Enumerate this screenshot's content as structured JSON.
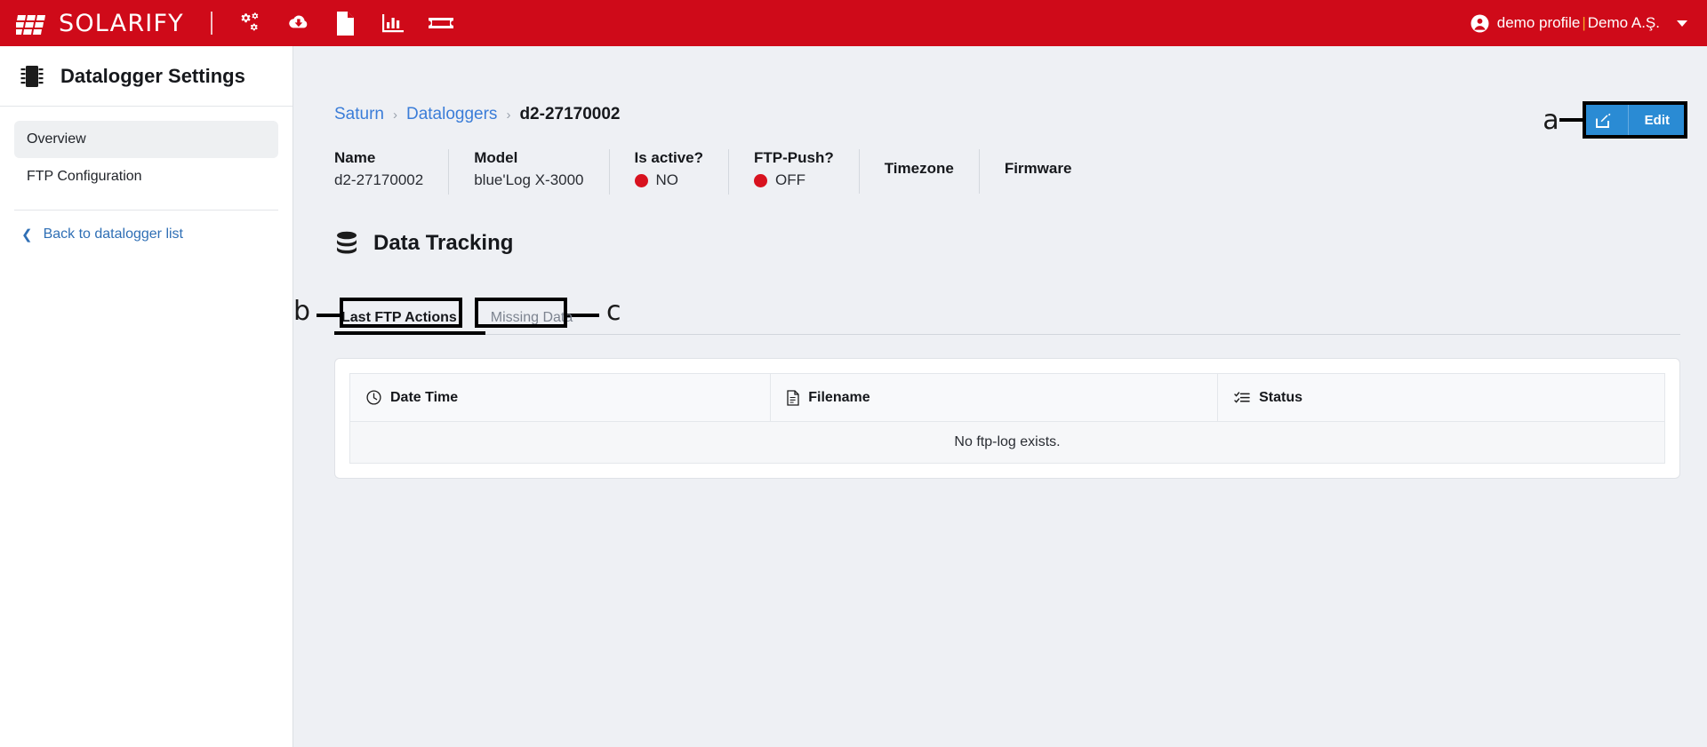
{
  "topbar": {
    "brand_name": "SOLARIFY",
    "brand_logo_icon": "solar-panel-icon",
    "icons": [
      {
        "name": "cogs-icon",
        "label": "Settings"
      },
      {
        "name": "cloud-download-icon",
        "label": "Downloads"
      },
      {
        "name": "file-document-icon",
        "label": "Documents"
      },
      {
        "name": "bar-chart-icon",
        "label": "Reports"
      },
      {
        "name": "ticket-icon",
        "label": "Tickets"
      }
    ],
    "user": {
      "icon": "user-circle-icon",
      "profile": "demo profile",
      "separator": "|",
      "company": "Demo A.Ş.",
      "caret": "chevron-down-icon",
      "separator_color": "#f5a623"
    }
  },
  "sidebar": {
    "icon": "microchip-icon",
    "title": "Datalogger Settings",
    "items": [
      {
        "label": "Overview",
        "active": true
      },
      {
        "label": "FTP Configuration",
        "active": false
      }
    ],
    "back_link": {
      "label": "Back to datalogger list",
      "icon": "chevron-left-icon"
    }
  },
  "breadcrumb": {
    "items": [
      "Saturn",
      "Dataloggers"
    ],
    "separator": "›",
    "current": "d2-27170002"
  },
  "info_bar": [
    {
      "label": "Name",
      "value": "d2-27170002",
      "dot": null
    },
    {
      "label": "Model",
      "value": "blue'Log X-3000",
      "dot": null
    },
    {
      "label": "Is active?",
      "value": "NO",
      "dot": "#d8121f"
    },
    {
      "label": "FTP-Push?",
      "value": "OFF",
      "dot": "#d8121f"
    },
    {
      "label": "Timezone",
      "value": "",
      "dot": null
    },
    {
      "label": "Firmware",
      "value": "",
      "dot": null
    }
  ],
  "edit_button": {
    "label": "Edit",
    "icon": "edit-pencil-icon",
    "color": "#2a8bd4",
    "annotation": "a"
  },
  "section": {
    "icon": "database-icon",
    "title": "Data Tracking"
  },
  "tabs": [
    {
      "label": "Last FTP Actions",
      "active": true,
      "annotation": "b"
    },
    {
      "label": "Missing Data",
      "active": false,
      "annotation": "c"
    }
  ],
  "table": {
    "columns": [
      {
        "label": "Date Time",
        "icon": "clock-icon"
      },
      {
        "label": "Filename",
        "icon": "file-icon"
      },
      {
        "label": "Status",
        "icon": "tasks-list-icon"
      }
    ],
    "rows": [],
    "empty_message": "No ftp-log exists."
  }
}
